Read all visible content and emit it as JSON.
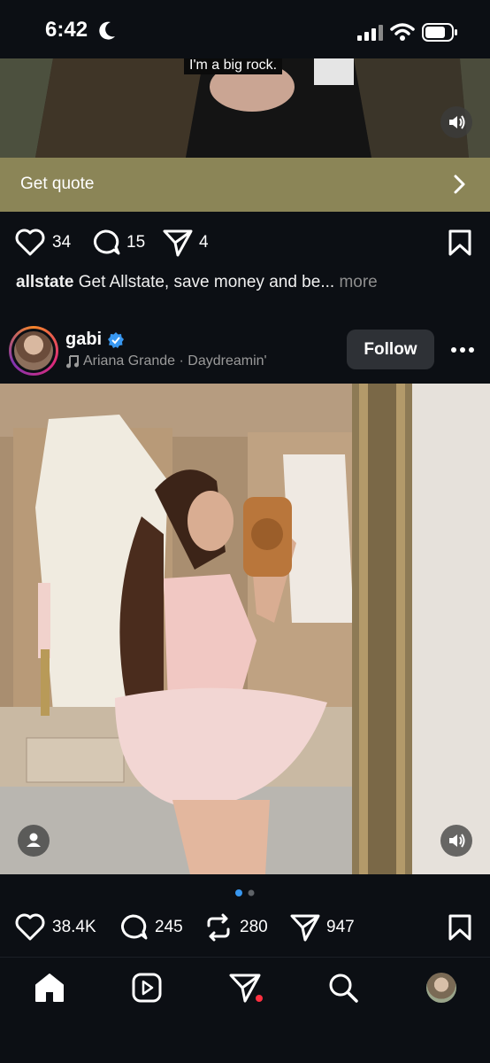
{
  "status_bar": {
    "time": "6:42"
  },
  "ad_post": {
    "video_caption": "I'm a big rock.",
    "cta_label": "Get quote",
    "likes": "34",
    "comments": "15",
    "shares": "4",
    "caption_user": "allstate",
    "caption_text": " Get Allstate, save money and be... ",
    "caption_more": "more"
  },
  "post": {
    "username": "gabi",
    "music": "Ariana Grande · Daydreamin'",
    "follow_label": "Follow",
    "likes": "38.4K",
    "comments": "245",
    "reposts": "280",
    "shares": "947"
  },
  "colors": {
    "accent": "#3897f0",
    "cta": "#8b8557",
    "notification": "#ff3040"
  },
  "icons": [
    "moon-icon",
    "signal-icon",
    "wifi-icon",
    "battery-icon",
    "speaker-icon",
    "heart-icon",
    "comment-icon",
    "share-icon",
    "bookmark-icon",
    "verified-icon",
    "music-note-icon",
    "more-icon",
    "user-tag-icon",
    "repost-icon",
    "home-icon",
    "reels-icon",
    "search-icon",
    "profile-avatar"
  ]
}
